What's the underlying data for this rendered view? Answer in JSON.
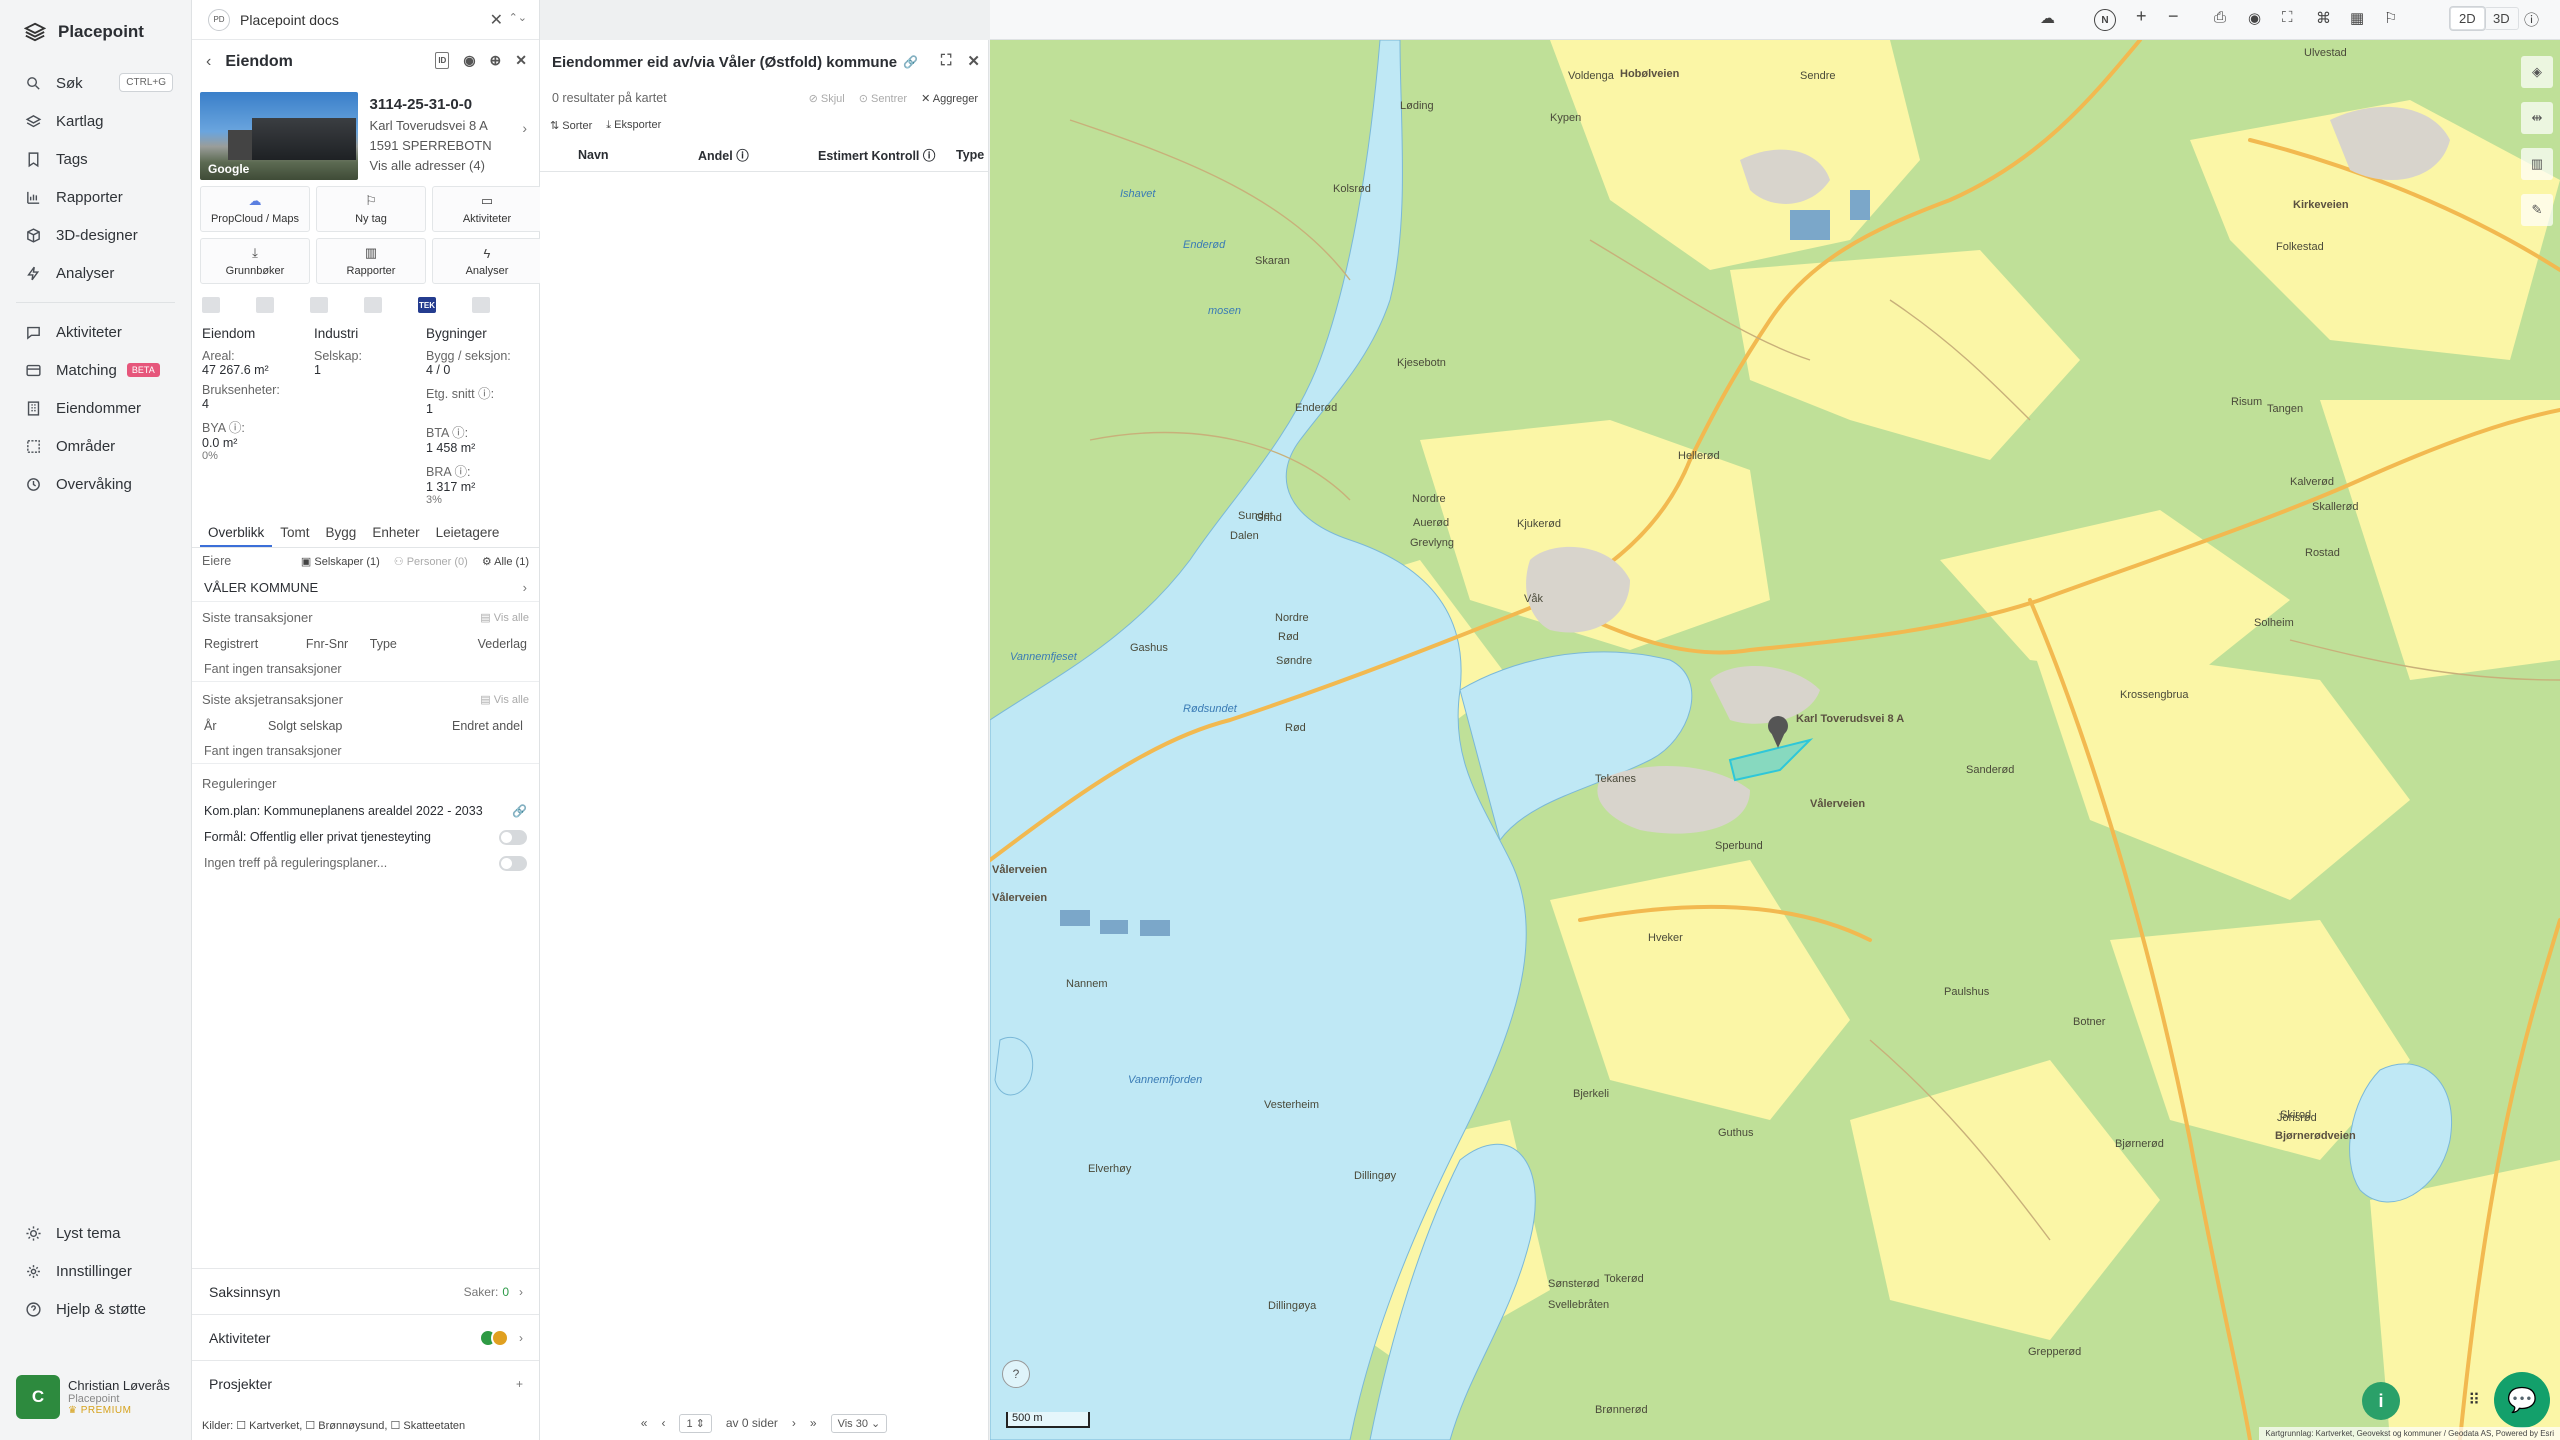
{
  "nav": {
    "brand": "Placepoint",
    "items": [
      {
        "label": "Søk",
        "icon": "search-icon",
        "shortcut": "CTRL+G"
      },
      {
        "label": "Kartlag",
        "icon": "layers-icon"
      },
      {
        "label": "Tags",
        "icon": "bookmark-icon"
      },
      {
        "label": "Rapporter",
        "icon": "chart-icon"
      },
      {
        "label": "3D-designer",
        "icon": "cube-icon"
      },
      {
        "label": "Analyser",
        "icon": "bolt-icon"
      }
    ],
    "items2": [
      {
        "label": "Aktiviteter",
        "icon": "chat-icon"
      },
      {
        "label": "Matching",
        "icon": "match-icon",
        "badge": "BETA"
      },
      {
        "label": "Eiendommer",
        "icon": "building-icon"
      },
      {
        "label": "Områder",
        "icon": "area-icon"
      },
      {
        "label": "Overvåking",
        "icon": "clock-icon"
      }
    ],
    "bottom": [
      {
        "label": "Lyst tema",
        "icon": "sun-icon"
      },
      {
        "label": "Innstillinger",
        "icon": "gear-icon"
      },
      {
        "label": "Hjelp & støtte",
        "icon": "help-icon"
      }
    ],
    "user": {
      "initial": "C",
      "name": "Christian Løverås",
      "org": "Placepoint",
      "tier": "PREMIUM"
    }
  },
  "docs": {
    "badge": "PD",
    "title": "Placepoint docs"
  },
  "property": {
    "header": "Eiendom",
    "id": "3114-25-31-0-0",
    "address": "Karl Toverudsvei 8 A",
    "postal": "1591 SPERREBOTN",
    "all_addresses": "Vis alle adresser (4)",
    "photo_credit": "Google",
    "buttons": [
      {
        "label": "PropCloud / Maps",
        "icon": "cloud-icon"
      },
      {
        "label": "Ny tag",
        "icon": "bookmark-icon"
      },
      {
        "label": "Aktiviteter",
        "icon": "chat-icon"
      },
      {
        "label": "Grunnbøker",
        "icon": "download-icon"
      },
      {
        "label": "Rapporter",
        "icon": "chart-icon"
      },
      {
        "label": "Analyser",
        "icon": "bolt-icon"
      }
    ],
    "tek_badge": "TEK",
    "stats": {
      "col1": {
        "h": "Eiendom",
        "areal_l": "Areal:",
        "areal_v": "47 267.6 m²",
        "bruk_l": "Bruksenheter:",
        "bruk_v": "4",
        "bya_l": "BYA ⓘ:",
        "bya_v": "0.0 m²",
        "bya_p": "0%"
      },
      "col2": {
        "h": "Industri",
        "selskap_l": "Selskap:",
        "selskap_v": "1"
      },
      "col3": {
        "h": "Bygninger",
        "bygg_l": "Bygg / seksjon:",
        "bygg_v": "4 / 0",
        "etg_l": "Etg. snitt ⓘ:",
        "etg_v": "1",
        "bta_l": "BTA ⓘ:",
        "bta_v": "1 458  m²",
        "bra_l": "BRA ⓘ:",
        "bra_v": "1 317 m²",
        "bra_p": "3%"
      }
    },
    "tabs": [
      "Overblikk",
      "Tomt",
      "Bygg",
      "Enheter",
      "Leietagere"
    ],
    "owners": {
      "label": "Eiere",
      "chip1": "Selskaper (1)",
      "chip2": "Personer (0)",
      "chip3": "Alle (1)",
      "row": "VÅLER KOMMUNE"
    },
    "transactions": {
      "label": "Siste transaksjoner",
      "show_all": "Vis alle",
      "cols": [
        "Registrert",
        "Fnr-Snr",
        "Type",
        "Vederlag"
      ],
      "empty": "Fant ingen transaksjoner"
    },
    "share_tx": {
      "label": "Siste aksjetransaksjoner",
      "show_all": "Vis alle",
      "cols": [
        "År",
        "Solgt selskap",
        "Endret andel"
      ],
      "empty": "Fant ingen transaksjoner"
    },
    "regulations": {
      "label": "Reguleringer",
      "plan": "Kom.plan: Kommuneplanens arealdel 2022 - 2033",
      "purpose": "Formål: Offentlig eller privat tjenesteyting",
      "none": "Ingen treff på reguleringsplaner..."
    },
    "accordions": {
      "saksinnsyn": "Saksinnsyn",
      "saker_label": "Saker:",
      "saker_value": "0",
      "aktiviteter": "Aktiviteter",
      "prosjekter": "Prosjekter"
    },
    "sources": "Kilder: ☐ Kartverket, ☐ Brønnøysund, ☐ Skatteetaten"
  },
  "results": {
    "title": "Eiendommer eid av/via Våler (Østfold) kommune",
    "count": "0 resultater på kartet",
    "actions": [
      "Skjul",
      "Sentrer",
      "Aggreger"
    ],
    "tools": [
      "Sorter",
      "Eksporter"
    ],
    "columns": [
      "Navn",
      "Andel ⓘ",
      "Estimert Kontroll ⓘ",
      "Type"
    ],
    "pager": {
      "page": "1",
      "of": "av 0 sider",
      "per": "Vis 30"
    }
  },
  "map": {
    "labels": [
      {
        "t": "Hobølveien",
        "c": "road"
      },
      {
        "t": "Voldenga",
        "c": ""
      },
      {
        "t": "Kypen",
        "c": ""
      },
      {
        "t": "Sendre",
        "c": ""
      },
      {
        "t": "Løding",
        "c": ""
      },
      {
        "t": "Kolsrød",
        "c": ""
      },
      {
        "t": "Skaran",
        "c": ""
      },
      {
        "t": "Ishavet",
        "c": "water"
      },
      {
        "t": "Enderød",
        "c": "water"
      },
      {
        "t": "mosen",
        "c": "water"
      },
      {
        "t": "Kjesebotn",
        "c": ""
      },
      {
        "t": "Enderød",
        "c": ""
      },
      {
        "t": "Hellerød",
        "c": ""
      },
      {
        "t": "Sundet",
        "c": ""
      },
      {
        "t": "Grind",
        "c": ""
      },
      {
        "t": "Dalen",
        "c": ""
      },
      {
        "t": "Nordre",
        "c": ""
      },
      {
        "t": "Auerød",
        "c": ""
      },
      {
        "t": "Kjukerød",
        "c": ""
      },
      {
        "t": "Grevlyng",
        "c": ""
      },
      {
        "t": "Våk",
        "c": ""
      },
      {
        "t": "Gashus",
        "c": ""
      },
      {
        "t": "Nordre",
        "c": ""
      },
      {
        "t": "Rød",
        "c": ""
      },
      {
        "t": "Søndre",
        "c": ""
      },
      {
        "t": "Vannemfjeset",
        "c": "water"
      },
      {
        "t": "Rødsundet",
        "c": "water"
      },
      {
        "t": "Rød",
        "c": ""
      },
      {
        "t": "Karl Toverudsvei 8 A",
        "c": "road"
      },
      {
        "t": "Tekanes",
        "c": ""
      },
      {
        "t": "Vålerveien",
        "c": "road"
      },
      {
        "t": "Sperbund",
        "c": ""
      },
      {
        "t": "Vålerveien",
        "c": "road"
      },
      {
        "t": "Nannem",
        "c": ""
      },
      {
        "t": "Hveker",
        "c": ""
      },
      {
        "t": "Vannemfjorden",
        "c": "water"
      },
      {
        "t": "Vesterheim",
        "c": ""
      },
      {
        "t": "Elverhøy",
        "c": ""
      },
      {
        "t": "Dillingøy",
        "c": ""
      },
      {
        "t": "Bjerkeli",
        "c": ""
      },
      {
        "t": "Sønsterød",
        "c": ""
      },
      {
        "t": "Svellebråten",
        "c": ""
      },
      {
        "t": "Dillingøya",
        "c": ""
      },
      {
        "t": "Tokerød",
        "c": ""
      },
      {
        "t": "Brønnerød",
        "c": ""
      },
      {
        "t": "Guthus",
        "c": ""
      },
      {
        "t": "Bjørnerød",
        "c": ""
      },
      {
        "t": "Paulshus",
        "c": ""
      },
      {
        "t": "Botner",
        "c": ""
      },
      {
        "t": "Bjørnerødveien",
        "c": "road"
      },
      {
        "t": "Kirkeveien",
        "c": "road"
      },
      {
        "t": "Folkestad",
        "c": ""
      },
      {
        "t": "Risum",
        "c": ""
      },
      {
        "t": "Tangen",
        "c": ""
      },
      {
        "t": "Kalverød",
        "c": ""
      },
      {
        "t": "Skallerød",
        "c": ""
      },
      {
        "t": "Rostad",
        "c": ""
      },
      {
        "t": "Solheim",
        "c": ""
      },
      {
        "t": "Krossengbrua",
        "c": ""
      },
      {
        "t": "Sanderød",
        "c": ""
      },
      {
        "t": "Grepperød",
        "c": ""
      },
      {
        "t": "Skirod",
        "c": ""
      },
      {
        "t": "Jonsrød",
        "c": ""
      },
      {
        "t": "Ulvestad",
        "c": ""
      },
      {
        "t": "Vålerveien",
        "c": "road"
      }
    ],
    "scale": "500 m",
    "attribution": "Kartgrunnlag: Kartverket, Geovekst og kommuner / Geodata AS, Powered by Esri"
  },
  "toolbar": {
    "north": "N",
    "plus": "+",
    "minus": "−",
    "mode2d": "2D",
    "mode3d": "3D"
  },
  "colors": {
    "forest": "#bfe098",
    "field": "#fbf6a6",
    "water": "#bfe8f5",
    "road": "#f2b950",
    "accent": "#3c6fd8",
    "green": "#2aa069"
  }
}
